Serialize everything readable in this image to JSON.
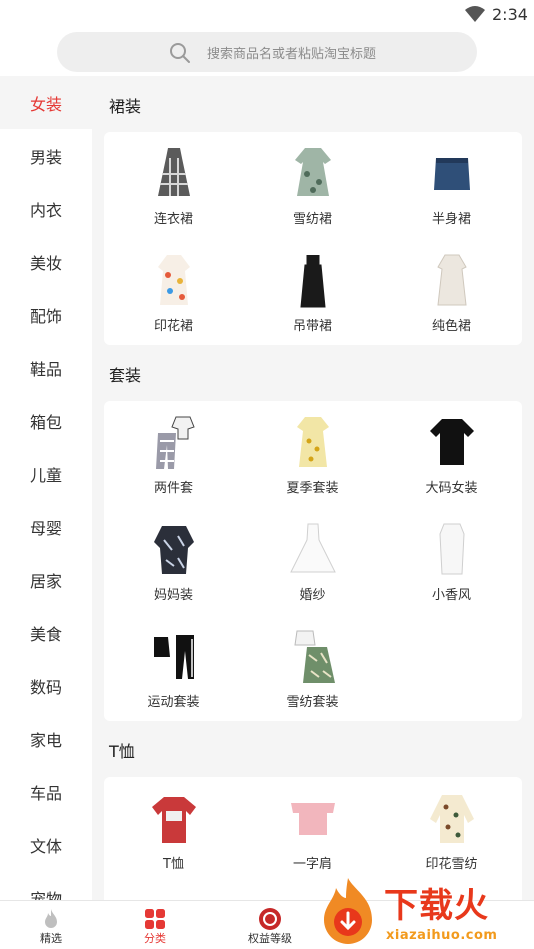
{
  "status_bar": {
    "time": "2:34"
  },
  "search": {
    "placeholder": "搜索商品名或者粘贴淘宝标题"
  },
  "sidebar": {
    "items": [
      {
        "label": "女装",
        "active": true
      },
      {
        "label": "男装"
      },
      {
        "label": "内衣"
      },
      {
        "label": "美妆"
      },
      {
        "label": "配饰"
      },
      {
        "label": "鞋品"
      },
      {
        "label": "箱包"
      },
      {
        "label": "儿童"
      },
      {
        "label": "母婴"
      },
      {
        "label": "居家"
      },
      {
        "label": "美食"
      },
      {
        "label": "数码"
      },
      {
        "label": "家电"
      },
      {
        "label": "车品"
      },
      {
        "label": "文体"
      },
      {
        "label": "宠物"
      }
    ]
  },
  "sections": [
    {
      "title": "裙装",
      "items": [
        {
          "label": "连衣裙",
          "icon": "plaid-dress-icon"
        },
        {
          "label": "雪纺裙",
          "icon": "floral-chiffon-dress-icon"
        },
        {
          "label": "半身裙",
          "icon": "denim-skirt-icon"
        },
        {
          "label": "印花裙",
          "icon": "print-dress-icon"
        },
        {
          "label": "吊带裙",
          "icon": "slip-dress-icon"
        },
        {
          "label": "纯色裙",
          "icon": "plain-dress-icon"
        }
      ]
    },
    {
      "title": "套装",
      "items": [
        {
          "label": "两件套",
          "icon": "two-piece-set-icon"
        },
        {
          "label": "夏季套装",
          "icon": "summer-set-icon"
        },
        {
          "label": "大码女装",
          "icon": "plus-size-tee-icon"
        },
        {
          "label": "妈妈装",
          "icon": "mom-wear-icon"
        },
        {
          "label": "婚纱",
          "icon": "wedding-dress-icon"
        },
        {
          "label": "小香风",
          "icon": "tweed-dress-icon"
        },
        {
          "label": "运动套装",
          "icon": "sport-set-icon"
        },
        {
          "label": "雪纺套装",
          "icon": "chiffon-set-icon"
        }
      ]
    },
    {
      "title": "T恤",
      "items": [
        {
          "label": "T恤",
          "icon": "red-tshirt-icon"
        },
        {
          "label": "一字肩",
          "icon": "off-shoulder-top-icon"
        },
        {
          "label": "印花雪纺",
          "icon": "print-chiffon-top-icon"
        }
      ]
    }
  ],
  "bottom_nav": {
    "items": [
      {
        "label": "精选",
        "icon": "flame-icon"
      },
      {
        "label": "分类",
        "icon": "category-grid-icon",
        "active": true
      },
      {
        "label": "权益等级",
        "icon": "coin-badge-icon"
      }
    ]
  },
  "watermark": {
    "title": "下载火",
    "url": "xiazaihuo.com"
  },
  "colors": {
    "accent": "#e53935",
    "content_bg": "#f5f5f5",
    "watermark_red": "#e8381b",
    "watermark_orange": "#f29a1d"
  }
}
